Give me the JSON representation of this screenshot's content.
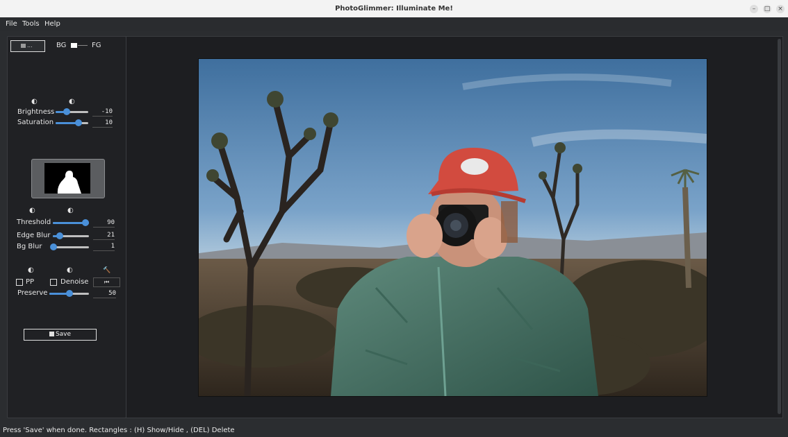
{
  "window": {
    "title": "PhotoGlimmer: Illuminate Me!",
    "controls": {
      "minimize": "–",
      "maximize": "□",
      "close": "×"
    }
  },
  "menu": {
    "file": "File",
    "tools": "Tools",
    "help": "Help"
  },
  "toolbar": {
    "color_button": "...",
    "bg_label": "BG",
    "fg_label": "FG"
  },
  "adjust": {
    "icon_a": "◐",
    "icon_b": "◐",
    "brightness": {
      "label": "Brightness",
      "value": "-10",
      "level": 0.35
    },
    "saturation": {
      "label": "Saturation",
      "value": "10",
      "level": 0.7
    }
  },
  "mask": {
    "icon_a": "◐",
    "icon_b": "◐",
    "threshold": {
      "label": "Threshold",
      "value": "90",
      "level": 0.9
    },
    "edge_blur": {
      "label": "Edge Blur",
      "value": "21",
      "level": 0.2
    },
    "bg_blur": {
      "label": "Bg Blur",
      "value": "1",
      "level": 0.02
    }
  },
  "postprocess": {
    "icon_a": "◐",
    "icon_b": "◐",
    "icon_c": "🔨",
    "pp_label": "PP",
    "pp_checked": false,
    "denoise_label": "Denoise",
    "denoise_checked": false,
    "denoise_value": "⏮",
    "preserve": {
      "label": "Preserve",
      "value": "50",
      "level": 0.5
    }
  },
  "save": {
    "label": "Save",
    "icon": "floppy-icon"
  },
  "status": "Press 'Save' when done. Rectangles : (H) Show/Hide , (DEL) Delete",
  "colors": {
    "accent": "#4a90d9",
    "panel": "#202124",
    "canvas": "#1d1e21"
  }
}
